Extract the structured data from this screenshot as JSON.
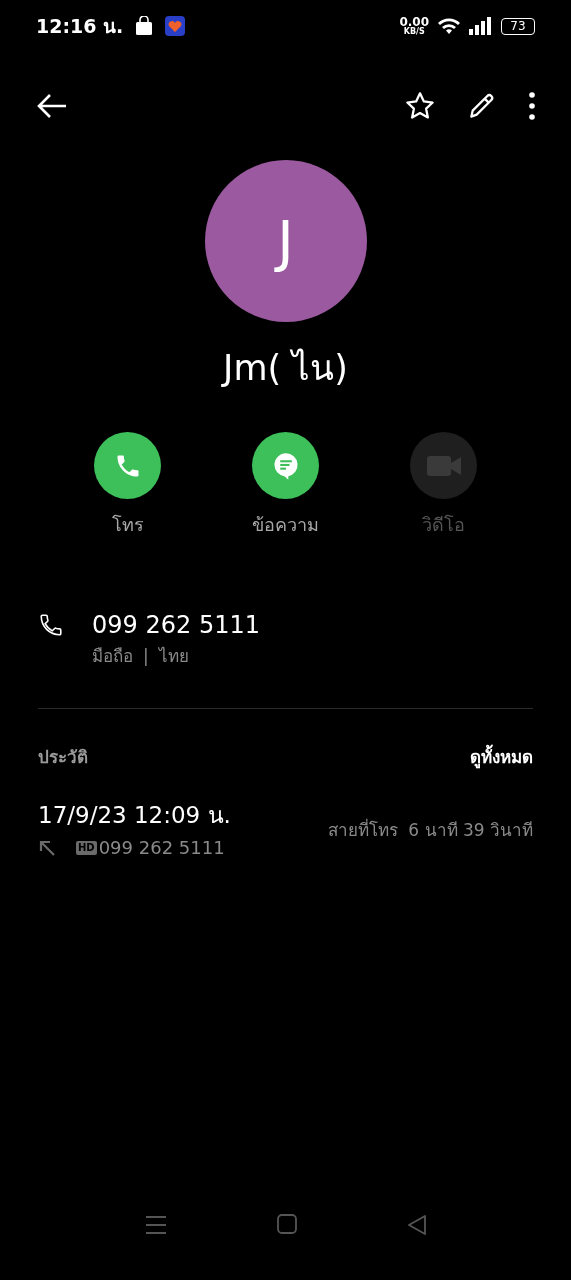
{
  "status_bar": {
    "time": "12:16 น.",
    "net_speed": "0.00",
    "net_unit": "KB/S",
    "battery": "73"
  },
  "contact": {
    "initial": "J",
    "name": "Jm( ไน)"
  },
  "actions": [
    {
      "kind": "call",
      "label": "โทร",
      "disabled": false
    },
    {
      "kind": "message",
      "label": "ข้อความ",
      "disabled": false
    },
    {
      "kind": "video",
      "label": "วิดีโอ",
      "disabled": true
    }
  ],
  "phone": {
    "number": "099 262 5111",
    "type": "มือถือ",
    "separator": "|",
    "region": "ไทย"
  },
  "history": {
    "title": "ประวัติ",
    "see_all": "ดูทั้งหมด",
    "entries": [
      {
        "datetime": "17/9/23 12:09 น.",
        "hd": "HD",
        "number": "099 262 5111",
        "duration": "สายที่โทร  6 นาที 39 วินาที"
      }
    ]
  }
}
